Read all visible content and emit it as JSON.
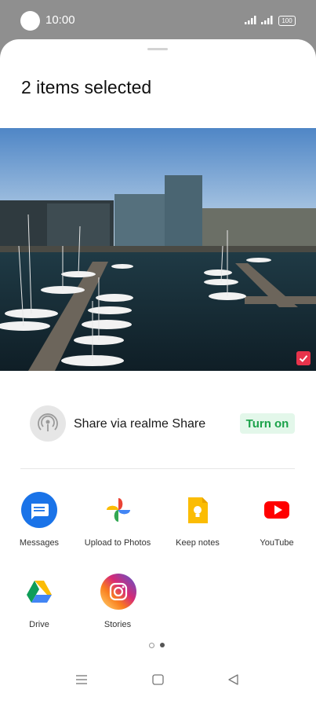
{
  "status_bar": {
    "time": "10:00",
    "battery": "100"
  },
  "sheet": {
    "title": "2 items selected"
  },
  "share_via": {
    "label": "Share via realme Share",
    "button": "Turn on"
  },
  "apps": [
    {
      "label": "Messages",
      "icon": "messages-icon"
    },
    {
      "label": "Upload to Photos",
      "icon": "photos-icon"
    },
    {
      "label": "Keep notes",
      "icon": "keep-notes-icon"
    },
    {
      "label": "YouTube",
      "icon": "youtube-icon"
    },
    {
      "label": "Drive",
      "icon": "drive-icon"
    },
    {
      "label": "Stories",
      "icon": "instagram-icon"
    }
  ],
  "pager": {
    "pages": 2,
    "current": 2
  },
  "colors": {
    "accent_green": "#1ba24a",
    "check_red": "#e7334b",
    "messages_blue": "#1a73e8",
    "youtube_red": "#ff0000"
  }
}
